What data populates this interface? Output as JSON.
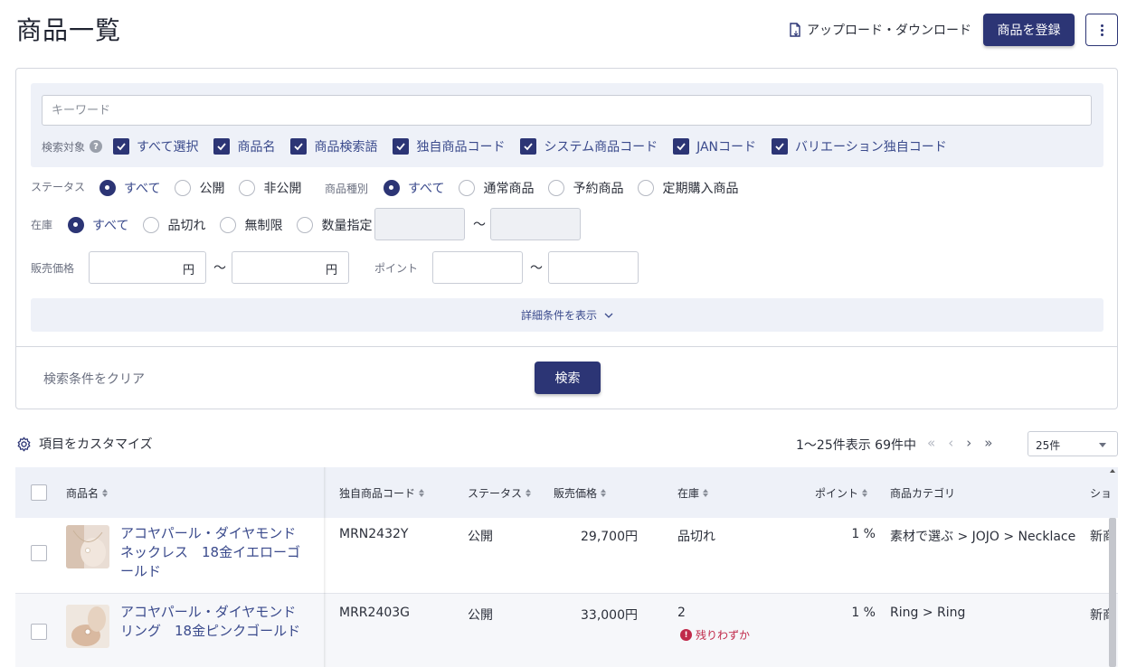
{
  "header": {
    "title": "商品一覧",
    "upload_download_label": "アップロード・ダウンロード",
    "register_button_label": "商品を登録"
  },
  "search": {
    "keyword_placeholder": "キーワード",
    "target_label": "検索対象",
    "targets": [
      "すべて選択",
      "商品名",
      "商品検索語",
      "独自商品コード",
      "システム商品コード",
      "JANコード",
      "バリエーション独自コード"
    ],
    "status_label": "ステータス",
    "status_options": [
      "すべて",
      "公開",
      "非公開"
    ],
    "product_type_label": "商品種別",
    "product_type_options": [
      "すべて",
      "通常商品",
      "予約商品",
      "定期購入商品"
    ],
    "stock_label": "在庫",
    "stock_options": [
      "すべて",
      "品切れ",
      "無制限",
      "数量指定"
    ],
    "price_label": "販売価格",
    "price_unit": "円",
    "point_label": "ポイント",
    "tilde": "～",
    "detail_toggle_label": "詳細条件を表示",
    "clear_label": "検索条件をクリア",
    "search_button_label": "検索"
  },
  "list": {
    "customize_label": "項目をカスタマイズ",
    "count_text": "1～25件表示 69件中",
    "per_page": "25件"
  },
  "table": {
    "columns": {
      "name": "商品名",
      "code": "独自商品コード",
      "status": "ステータス",
      "price": "販売価格",
      "stock": "在庫",
      "point": "ポイント",
      "category": "商品カテゴリ",
      "more": "ショ"
    },
    "rows": [
      {
        "name": "アコヤパール・ダイヤモンドネックレス　18金イエローゴールド",
        "code": "MRN2432Y",
        "status": "公開",
        "price": "29,700円",
        "stock": "品切れ",
        "stock_note": "",
        "point": "1 %",
        "category": "素材で選ぶ > JOJO > Necklace",
        "more": "新商"
      },
      {
        "name": "アコヤパール・ダイヤモンドリング　18金ピンクゴールド",
        "code": "MRR2403G",
        "status": "公開",
        "price": "33,000円",
        "stock": "2",
        "stock_note": "残りわずか",
        "point": "1 %",
        "category": "Ring > Ring",
        "more": "新商"
      }
    ]
  },
  "colors": {
    "primary": "#2c3575",
    "link": "#3a4a8c",
    "warning": "#c0294a",
    "panel_bg": "#eef1f8"
  }
}
